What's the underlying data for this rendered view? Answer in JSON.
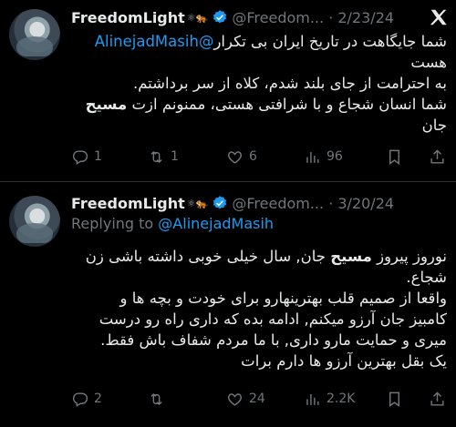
{
  "tweets": [
    {
      "name": "FreedomLight",
      "name_symbols": "⚛🐅",
      "handle": "@Freedom...",
      "date": "2/23/24",
      "replying_to": "",
      "mention": "@AlinejadMasih",
      "line1_rest": " شما جایگاهت در تاریخ ایران بی تکرار",
      "line2": "هست",
      "line3": "به احترامت از جای بلند شدم، کلاه از سر برداشتم.",
      "line4_pre": "شما انسان شجاع و با شرافتی هستی، ممنونم ازت ",
      "line4_bold": "مسیح",
      "line5": "جان",
      "reply_count": "1",
      "retweet_count": "1",
      "like_count": "6",
      "view_count": "96"
    },
    {
      "name": "FreedomLight",
      "name_symbols": "⚛🐅",
      "handle": "@Freedom...",
      "date": "3/20/24",
      "replying_label": "Replying to ",
      "replying_to": "@AlinejadMasih",
      "line1_pre": "نوروز پیروز ",
      "line1_bold": "مسیح",
      "line1_post": " جان, سال خیلی خوبی داشته باشی زن",
      "line2": "شجاع.",
      "line3": "واقعا از صمیم قلب بهترینهارو برای خودت و بچه ها و",
      "line4": "کامبیز جان آرزو میکنم, ادامه بده که داری راه رو درست",
      "line5": "میری و حمایت مارو داری, با ما مردم شفاف باش فقط.",
      "line6": "یک بقل بهترین آرزو ها دارم برات",
      "reply_count": "2",
      "retweet_count": "",
      "like_count": "24",
      "view_count": "2.2K"
    }
  ],
  "icons": {
    "x_logo": "X",
    "reply": "reply-icon",
    "retweet": "retweet-icon",
    "like": "heart-icon",
    "views": "views-icon",
    "bookmark": "bookmark-icon",
    "share": "share-icon",
    "verified": "verified-badge-icon"
  },
  "colors": {
    "background": "#000000",
    "text": "#e7e9ea",
    "muted": "#71767b",
    "link": "#1d9bf0"
  }
}
